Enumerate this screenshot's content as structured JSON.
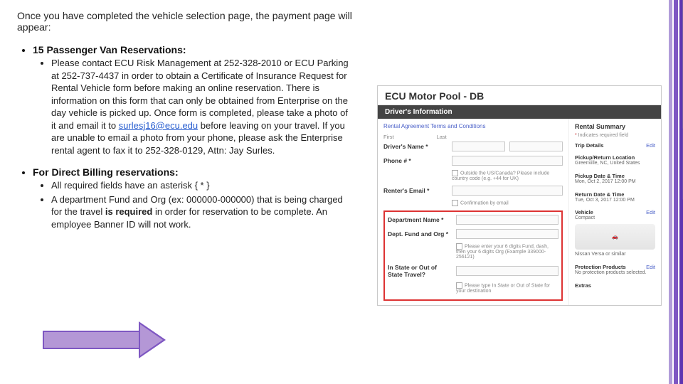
{
  "intro": "Once you have completed the vehicle selection page, the payment page will appear:",
  "section1": {
    "heading": "15 Passenger Van Reservations:",
    "body_pre": "Please contact ECU Risk Management at 252-328-2010 or ECU Parking at 252-737-4437 in order to obtain a Certificate of Insurance Request for Rental Vehicle form before making an online reservation. There is information on this form that can only be obtained from Enterprise on the day vehicle is picked up.  Once form is completed, please take a photo of it and email it to ",
    "email": "surlesj16@ecu.edu",
    "body_post": " before leaving on your travel. If you are unable to email a photo from your phone, please ask the Enterprise rental agent to fax it to 252-328-0129, Attn: Jay Surles."
  },
  "section2": {
    "heading": "For Direct Billing reservations:",
    "b1": "All required fields have an asterisk { * }",
    "b2_pre": "A department Fund and Org (ex: 000000-000000) that is being charged for the travel ",
    "b2_bold": "is required",
    "b2_post": " in order for reservation to be complete.  An employee Banner ID will not work."
  },
  "form": {
    "title": "ECU Motor Pool - DB",
    "bar": "Driver's Information",
    "terms": "Rental Agreement Terms and Conditions",
    "first": "First",
    "last": "Last",
    "name": "Driver's Name *",
    "phone": "Phone # *",
    "phone_hint": "Outside the US/Canada? Please include country code (e.g. +44 for UK)",
    "email": "Renter's Email *",
    "conf": "Confirmation by email",
    "dept": "Department Name *",
    "fund": "Dept. Fund and Org *",
    "fund_hint": "Please enter your 6 digits Fund, dash, then your 6 digits Org (Example 339000-256121)",
    "state": "In State or Out of State Travel?",
    "state_hint": "Please type In State or Out of State for your destination",
    "right": {
      "summary": "Rental Summary",
      "req": "Indicates required field",
      "trip": "Trip Details",
      "edit": "Edit",
      "pickup_loc_h": "Pickup/Return Location",
      "pickup_loc_v": "Greenville, NC, United States",
      "pickup_dt_h": "Pickup Date & Time",
      "pickup_dt_v": "Mon, Oct 2, 2017 12:00 PM",
      "return_dt_h": "Return Date & Time",
      "return_dt_v": "Tue, Oct 3, 2017 12:00 PM",
      "vehicle_h": "Vehicle",
      "vehicle_v": "Compact",
      "vehicle_model": "Nissan Versa or similar",
      "prot_h": "Protection Products",
      "prot_v": "No protection products selected.",
      "extras_h": "Extras"
    }
  }
}
